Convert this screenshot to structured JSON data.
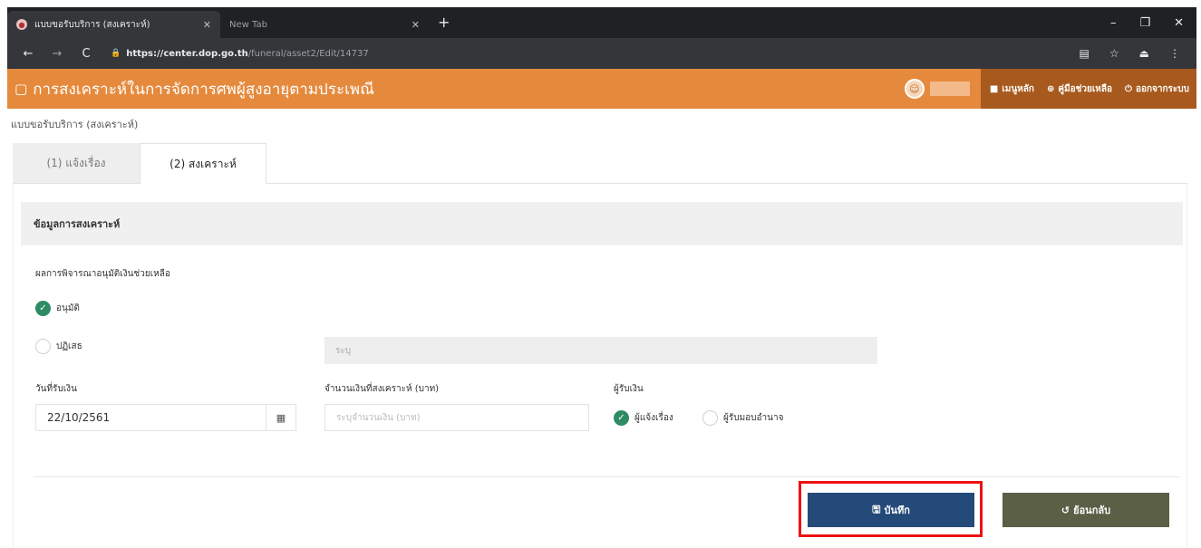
{
  "browser": {
    "tabs": [
      {
        "title": "แบบขอรับบริการ (สงเคราะห์)",
        "close": "✕"
      },
      {
        "title": "New Tab",
        "close": "✕"
      }
    ],
    "new_tab": "+",
    "window_controls": [
      "–",
      "❐",
      "✕"
    ],
    "url_host": "https://center.dop.go.th",
    "url_path": "/funeral/asset2/Edit/14737"
  },
  "app": {
    "title": "การสงเคราะห์ในการจัดการศพผู้สูงอายุตามประเพณี",
    "menu": [
      {
        "icon": "■",
        "label": "เมนูหลัก"
      },
      {
        "icon": "⊕",
        "label": "คู่มือช่วยเหลือ"
      },
      {
        "icon": "⏻",
        "label": "ออกจากระบบ"
      }
    ]
  },
  "page": {
    "breadcrumb": "แบบขอรับบริการ (สงเคราะห์)",
    "tabs": [
      "(1) แจ้งเรื่อง",
      "(2) สงเคราะห์"
    ],
    "section_title": "ข้อมูลการสงเคราะห์",
    "decision_label": "ผลการพิจารณาอนุมัติเงินช่วยเหลือ",
    "approve_label": "อนุมัติ",
    "reject_label": "ปฏิเสธ",
    "reason_placeholder": "ระบุ",
    "date_label": "วันที่รับเงิน",
    "date_value": "22/10/2561",
    "amount_label": "จำนวนเงินที่สงเคราะห์ (บาท)",
    "amount_placeholder": "ระบุจำนวนเงิน (บาท)",
    "receiver_label": "ผู้รับเงิน",
    "receiver_option1": "ผู้แจ้งเรื่อง",
    "receiver_option2": "ผู้รับมอบอำนาจ",
    "save_label": "บันทึก",
    "back_label": "ย้อนกลับ"
  },
  "colors": {
    "header_orange": "#e58a3d",
    "menu_brown": "#a85a1e",
    "check_green": "#2e8b64",
    "save_blue": "#234a78",
    "back_olive": "#5a5f46",
    "highlight_red": "#e11111"
  }
}
